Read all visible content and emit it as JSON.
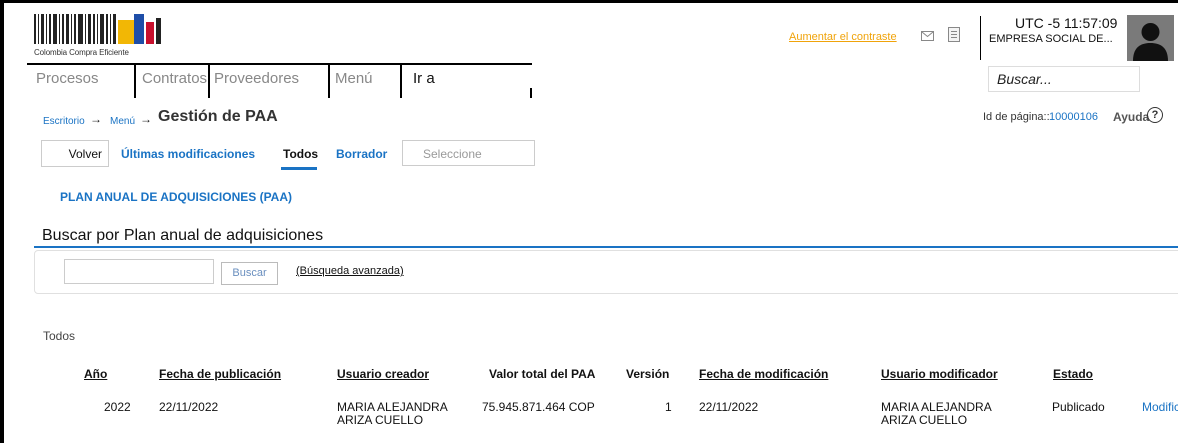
{
  "logo": {
    "text": "Colombia Compra Eficiente"
  },
  "header": {
    "contrast_link": "Aumentar el contraste",
    "icons": [
      "mail-icon",
      "document-icon"
    ],
    "timezone": "UTC -5",
    "time": "11:57:09",
    "company": "EMPRESA SOCIAL DE...",
    "avatar_icon": "user-avatar-icon"
  },
  "nav": {
    "items": [
      "Procesos",
      "Contratos",
      "Proveedores",
      "Menú",
      "Ir a"
    ],
    "search_placeholder": "Buscar..."
  },
  "breadcrumb": {
    "items": [
      "Escritorio",
      "Menú"
    ],
    "title": "Gestión de PAA"
  },
  "page_info": {
    "id_label": "Id de página::",
    "id_value": "10000106",
    "help_label": "Ayuda",
    "help_icon": "?"
  },
  "toolbar": {
    "back_label": "Volver",
    "tabs": [
      "Últimas modificaciones",
      "Todos",
      "Borrador"
    ],
    "active_tab": "Todos",
    "select_value": "Seleccione"
  },
  "paa_link": "PLAN ANUAL DE ADQUISICIONES (PAA)",
  "search": {
    "title": "Buscar por Plan anual de adquisiciones",
    "query": "",
    "button": "Buscar",
    "advanced": "(Búsqueda avanzada)"
  },
  "results": {
    "label": "Todos",
    "headers": [
      "Año",
      "Fecha de publicación",
      "Usuario creador",
      "Valor total del PAA",
      "Versión",
      "Fecha de modificación",
      "Usuario modificador",
      "Estado"
    ],
    "rows": [
      {
        "year": "2022",
        "published": "22/11/2022",
        "creator_line1": "MARIA ALEJANDRA",
        "creator_line2": "ARIZA CUELLO",
        "total": "75.945.871.464 COP",
        "version": "1",
        "modified": "22/11/2022",
        "modifier_line1": "MARIA ALEJANDRA",
        "modifier_line2": "ARIZA CUELLO",
        "status": "Publicado",
        "action": "Modificar"
      }
    ]
  },
  "colors": {
    "accent": "#1a73c4",
    "contrast_link": "#f0a30a"
  }
}
